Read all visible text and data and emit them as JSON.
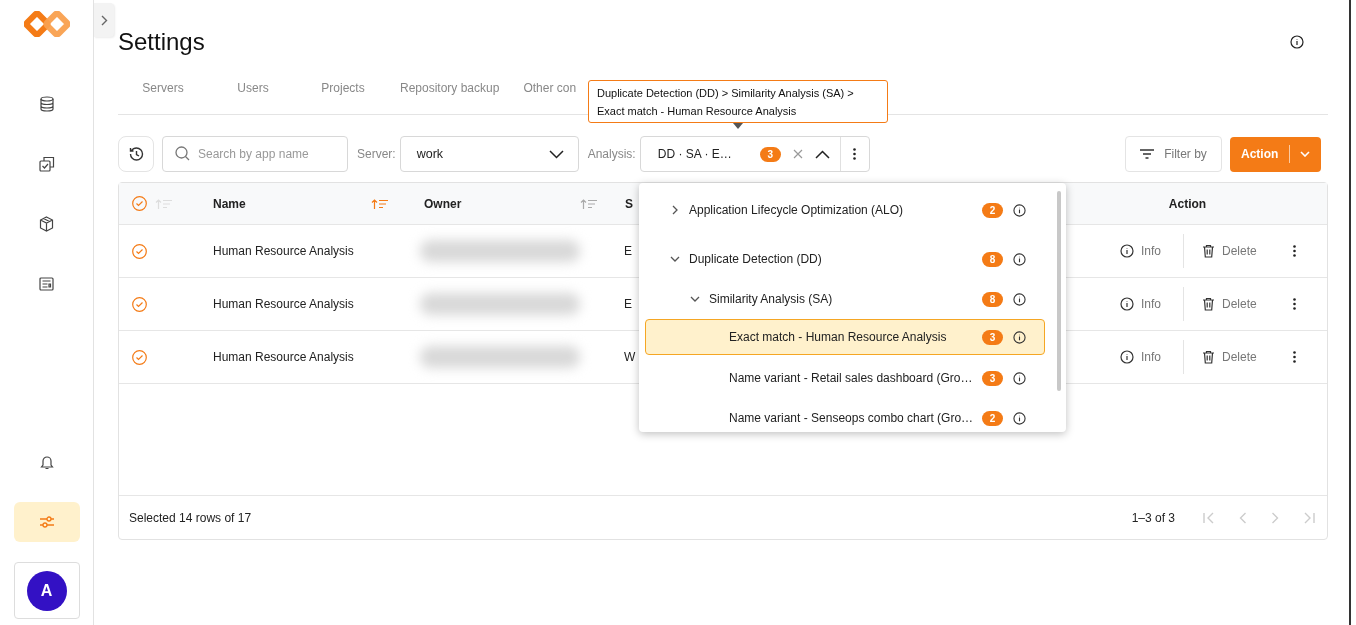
{
  "sidebar": {
    "items": [
      {
        "kind": "database",
        "selected": false
      },
      {
        "kind": "copies",
        "selected": false
      },
      {
        "kind": "box",
        "selected": false
      },
      {
        "kind": "document",
        "selected": false
      }
    ],
    "bottom_items": [
      {
        "kind": "bell",
        "selected": false
      },
      {
        "kind": "settings",
        "selected": true
      }
    ],
    "avatar": {
      "initial": "A"
    }
  },
  "page": {
    "title": "Settings"
  },
  "tabs": [
    {
      "label": "Servers",
      "selected": false
    },
    {
      "label": "Users",
      "selected": false
    },
    {
      "label": "Projects",
      "selected": false
    },
    {
      "label": "Repository backup",
      "selected": false
    },
    {
      "label": "Other con",
      "selected": false
    }
  ],
  "tooltip": {
    "lines": [
      "Duplicate Detection (DD) > Similarity Analysis (SA) >",
      "Exact match - Human Resource Analysis"
    ]
  },
  "toolbar": {
    "search": {
      "placeholder": "Search by app name"
    },
    "server": {
      "label": "Server:",
      "value": "work"
    },
    "analysis": {
      "label": "Analysis:",
      "value": "DD · SA · E…",
      "count": "3",
      "expanded": true
    },
    "filter_button": "Filter by",
    "action_button": "Action"
  },
  "table": {
    "all_checked": true,
    "columns": [
      {
        "label": "Name",
        "sorted": true
      },
      {
        "label": "Owner",
        "sorted": false
      },
      {
        "label": "S"
      },
      {
        "label": "Action"
      }
    ],
    "rows": [
      {
        "checked": true,
        "name": "Human Resource Analysis",
        "column_3": "E",
        "info": "Info",
        "delete": "Delete"
      },
      {
        "checked": true,
        "name": "Human Resource Analysis",
        "column_3": "E",
        "info": "Info",
        "delete": "Delete"
      },
      {
        "checked": true,
        "name": "Human Resource Analysis",
        "column_3": "W",
        "info": "Info",
        "delete": "Delete"
      }
    ],
    "footer": "Selected 14 rows of 17",
    "pagination": "1–3 of 3"
  },
  "dropdown": {
    "items": [
      {
        "label": "Application Lifecycle Optimization (ALO)",
        "count": "2",
        "expanded": false,
        "selected": false
      },
      {
        "label": "Duplicate Detection (DD)",
        "count": "8",
        "expanded": true,
        "selected": false,
        "children": [
          {
            "label": "Similarity Analysis (SA)",
            "count": "8",
            "expanded": true,
            "selected": false,
            "children": [
              {
                "label": "Exact match - Human Resource Analysis",
                "count": "3",
                "selected": true
              },
              {
                "label": "Name variant - Retail sales dashboard (Gro…",
                "count": "3",
                "selected": false
              },
              {
                "label": "Name variant - Senseops combo chart (Gro…",
                "count": "2",
                "selected": false
              }
            ]
          }
        ]
      }
    ]
  }
}
